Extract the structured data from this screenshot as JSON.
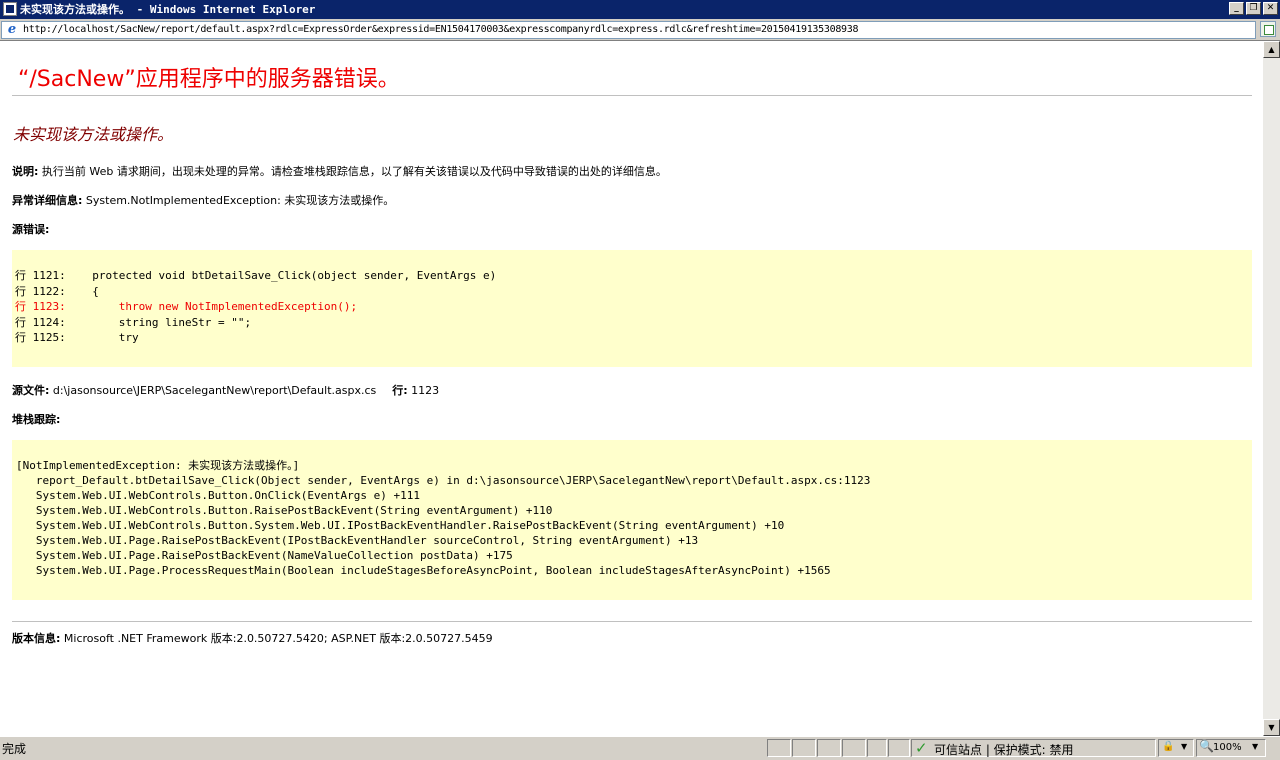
{
  "window": {
    "title": "未实现该方法或操作。 - Windows Internet Explorer",
    "minimize_glyph": "_",
    "restore_glyph": "❐",
    "close_glyph": "✕"
  },
  "address": {
    "url": "http://localhost/SacNew/report/default.aspx?rdlc=ExpressOrder&expressid=EN1504170003&expresscompanyrdlc=express.rdlc&refreshtime=20150419135308938"
  },
  "page": {
    "heading": "“/SacNew”应用程序中的服务器错误。",
    "error_title": "未实现该方法或操作。",
    "description_label": "说明:",
    "description_text": " 执行当前 Web 请求期间，出现未处理的异常。请检查堆栈跟踪信息，以了解有关该错误以及代码中导致错误的出处的详细信息。",
    "exception_label": "异常详细信息:",
    "exception_text": " System.NotImplementedException: 未实现该方法或操作。",
    "source_error_label": "源错误:",
    "source_lines": [
      "行 1121:    protected void btDetailSave_Click(object sender, EventArgs e)",
      "行 1122:    {",
      "行 1123:        throw new NotImplementedException();",
      "行 1124:        string lineStr = \"\";",
      "行 1125:        try"
    ],
    "source_file_label": "源文件:",
    "source_file_value": " d:\\jasonsource\\JERP\\SacelegantNew\\report\\Default.aspx.cs",
    "line_label": "行:",
    "line_value": " 1123",
    "stack_trace_label": "堆栈跟踪:",
    "stack_lines": [
      "[NotImplementedException: 未实现该方法或操作。]",
      "   report_Default.btDetailSave_Click(Object sender, EventArgs e) in d:\\jasonsource\\JERP\\SacelegantNew\\report\\Default.aspx.cs:1123",
      "   System.Web.UI.WebControls.Button.OnClick(EventArgs e) +111",
      "   System.Web.UI.WebControls.Button.RaisePostBackEvent(String eventArgument) +110",
      "   System.Web.UI.WebControls.Button.System.Web.UI.IPostBackEventHandler.RaisePostBackEvent(String eventArgument) +10",
      "   System.Web.UI.Page.RaisePostBackEvent(IPostBackEventHandler sourceControl, String eventArgument) +13",
      "   System.Web.UI.Page.RaisePostBackEvent(NameValueCollection postData) +175",
      "   System.Web.UI.Page.ProcessRequestMain(Boolean includeStagesBeforeAsyncPoint, Boolean includeStagesAfterAsyncPoint) +1565"
    ],
    "version_label": "版本信息:",
    "version_text": " Microsoft .NET Framework 版本:2.0.50727.5420; ASP.NET 版本:2.0.50727.5459"
  },
  "status": {
    "text": "完成",
    "zone": "可信站点 | 保护模式: 禁用",
    "zoom": "100%"
  },
  "colors": {
    "title_bar": "#0a246a",
    "heading": "#ee0000",
    "error_title": "#800000",
    "code_bg": "#ffffcc",
    "error_line": "#ee0000"
  }
}
